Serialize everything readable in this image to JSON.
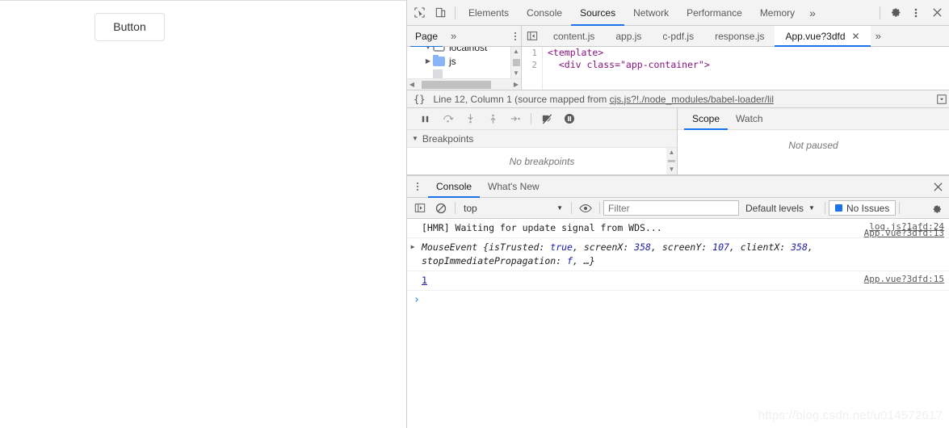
{
  "page": {
    "button_label": "Button"
  },
  "watermark": "https://blog.csdn.net/u014572617",
  "devtools": {
    "main_tabs": [
      {
        "label": "Elements",
        "active": false
      },
      {
        "label": "Console",
        "active": false
      },
      {
        "label": "Sources",
        "active": true
      },
      {
        "label": "Network",
        "active": false
      },
      {
        "label": "Performance",
        "active": false
      },
      {
        "label": "Memory",
        "active": false
      }
    ],
    "main_overflow": "»",
    "icons": {
      "inspect": "inspect-element-icon",
      "device": "device-toolbar-icon",
      "settings": "gear-icon",
      "more": "kebab-menu-icon",
      "close": "close-icon"
    },
    "navigator": {
      "title": "Page",
      "overflow": "»",
      "tree": [
        {
          "label": "localhost",
          "type": "domain",
          "cut_off": true
        },
        {
          "label": "js",
          "type": "folder",
          "expandable": true
        }
      ]
    },
    "editor": {
      "tabs": [
        {
          "label": "content.js",
          "active": false,
          "closable": false
        },
        {
          "label": "app.js",
          "active": false,
          "closable": false
        },
        {
          "label": "c-pdf.js",
          "active": false,
          "closable": false
        },
        {
          "label": "response.js",
          "active": false,
          "closable": false
        },
        {
          "label": "App.vue?3dfd",
          "active": true,
          "closable": true
        }
      ],
      "tabs_overflow": "»",
      "code": [
        {
          "number": "1",
          "content": "<template>"
        },
        {
          "number": "2",
          "content": "  <div class=\"app-container\">"
        }
      ],
      "status": {
        "braces": "{}",
        "prefix": "Line 12, Column 1  (source mapped from ",
        "link": "cjs.js?!./node_modules/babel-loader/lil",
        "full": "Line 12, Column 1  (source mapped from cjs.js?!./node_modules/babel-loader/lil"
      }
    },
    "debugger": {
      "toolbar_icons": [
        "pause-script-icon",
        "step-over-icon",
        "step-into-icon",
        "step-out-icon",
        "step-icon",
        "deactivate-breakpoints-icon",
        "pause-on-exceptions-icon"
      ],
      "breakpoints_section": "Breakpoints",
      "breakpoints_empty": "No breakpoints",
      "side_tabs": [
        {
          "label": "Scope",
          "active": true
        },
        {
          "label": "Watch",
          "active": false
        }
      ],
      "scope_empty": "Not paused"
    },
    "drawer": {
      "tabs": [
        {
          "label": "Console",
          "active": true
        },
        {
          "label": "What's New",
          "active": false
        }
      ],
      "console_toolbar": {
        "sidebar_toggle": "console-sidebar-icon",
        "clear": "clear-console-icon",
        "context": "top",
        "eye": "live-expression-icon",
        "filter_placeholder": "Filter",
        "filter_value": "",
        "levels": "Default levels",
        "issues": "No Issues",
        "settings": "gear-icon"
      },
      "messages": [
        {
          "type": "log",
          "arrow": "",
          "text": "[HMR] Waiting for update signal from WDS...",
          "source": "log.js?1afd:24"
        },
        {
          "type": "object",
          "arrow": "▶",
          "object_name": "MouseEvent",
          "props": [
            {
              "key": "isTrusted",
              "value": "true"
            },
            {
              "key": "screenX",
              "value": "358"
            },
            {
              "key": "screenY",
              "value": "107"
            },
            {
              "key": "clientX",
              "value": "358"
            },
            {
              "key": "stopImmediatePropagation",
              "value": "f"
            }
          ],
          "tail": "…}",
          "source": "App.vue?3dfd:13"
        },
        {
          "type": "number",
          "text": "1",
          "source": "App.vue?3dfd:15"
        }
      ],
      "prompt": "›"
    }
  },
  "colors": {
    "accent": "#1a73e8",
    "toolbar_bg": "#f3f3f3",
    "border": "#cdcdcd",
    "text": "#5a5a5a",
    "value_blue": "#1a1aa6",
    "folder_blue": "#8ab4f8"
  }
}
